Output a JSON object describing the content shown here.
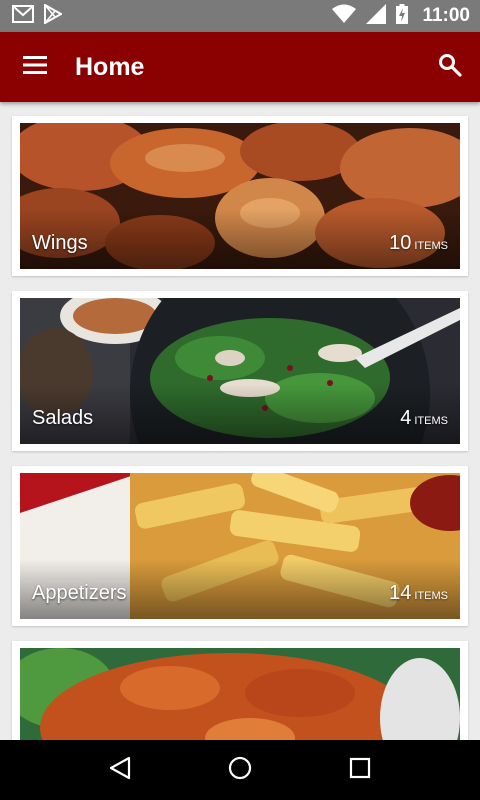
{
  "status_bar": {
    "time": "11:00",
    "icons": [
      "gmail-icon",
      "play-store-icon",
      "wifi-icon",
      "signal-icon",
      "battery-charging-icon"
    ]
  },
  "app_bar": {
    "title": "Home",
    "menu_icon": "hamburger-menu-icon",
    "search_icon": "search-icon",
    "color": "#8b0000"
  },
  "categories": [
    {
      "name": "Wings",
      "count": "10",
      "unit": "ITEMS"
    },
    {
      "name": "Salads",
      "count": "4",
      "unit": "ITEMS"
    },
    {
      "name": "Appetizers",
      "count": "14",
      "unit": "ITEMS"
    },
    {
      "name": "",
      "count": "",
      "unit": ""
    }
  ],
  "nav_bar": {
    "icons": [
      "back-icon",
      "home-icon",
      "recents-icon"
    ]
  }
}
